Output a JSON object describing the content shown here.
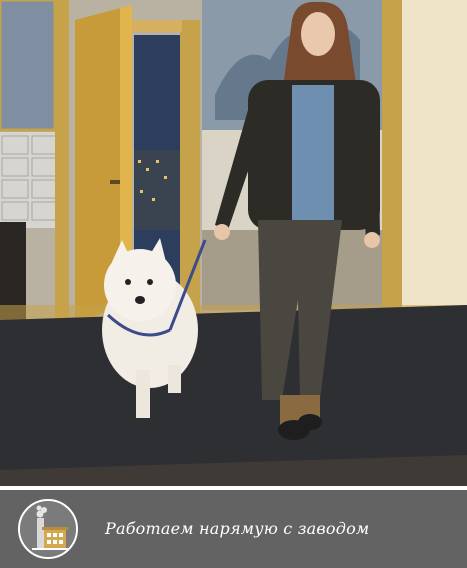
{
  "caption": {
    "text": "Работаем нарямую с заводом"
  },
  "badge": {
    "icon": "factory-icon"
  },
  "colors": {
    "caption_bar": "#636363",
    "badge_ring": "#ffffff",
    "carpet": "#2e2f33",
    "door_frame": "#c6a24a"
  }
}
